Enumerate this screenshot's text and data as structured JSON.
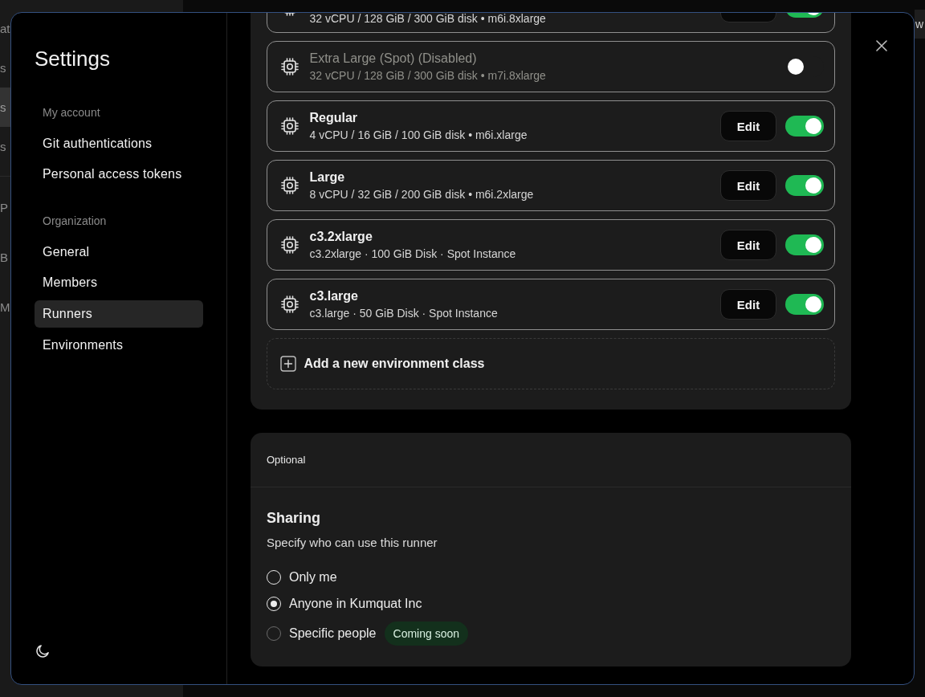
{
  "background": {
    "nav_groups": [
      {
        "items": [
          {
            "text": "at",
            "selected": false
          },
          {
            "text": "s",
            "selected": false
          },
          {
            "text": "s",
            "selected": true
          },
          {
            "text": "s",
            "selected": false
          }
        ]
      },
      {
        "items": [
          {
            "text": "P",
            "selected": false
          },
          {
            "text": "B",
            "selected": false
          },
          {
            "text": "M",
            "selected": false
          }
        ]
      }
    ],
    "top_button": {
      "text": "w"
    }
  },
  "dialog": {
    "sidebar": {
      "title": "Settings",
      "sections": [
        {
          "label": "My account",
          "items": [
            {
              "label": "Git authentications",
              "selected": false
            },
            {
              "label": "Personal access tokens",
              "selected": false
            }
          ]
        },
        {
          "label": "Organization",
          "items": [
            {
              "label": "General",
              "selected": false
            },
            {
              "label": "Members",
              "selected": false
            },
            {
              "label": "Runners",
              "selected": true
            },
            {
              "label": "Environments",
              "selected": false
            }
          ]
        }
      ]
    },
    "environment_classes": [
      {
        "specs": "32 vCPU / 128 GiB / 300 GiB disk • m6i.8xlarge",
        "has_edit": true,
        "enabled": true
      },
      {
        "name": "Extra Large (Spot) (Disabled)",
        "specs": "32 vCPU / 128 GiB / 300 GiB disk • m7i.8xlarge",
        "has_edit": false,
        "enabled": false
      },
      {
        "name": "Regular",
        "specs": "4 vCPU / 16 GiB / 100 GiB disk • m6i.xlarge",
        "has_edit": true,
        "edit_label": "Edit",
        "enabled": true
      },
      {
        "name": "Large",
        "specs": "8 vCPU / 32 GiB / 200 GiB disk • m6i.2xlarge",
        "has_edit": true,
        "edit_label": "Edit",
        "enabled": true
      },
      {
        "name": "c3.2xlarge",
        "specs": "c3.2xlarge · 100 GiB Disk · Spot Instance",
        "has_edit": true,
        "edit_label": "Edit",
        "enabled": true
      },
      {
        "name": "c3.large",
        "specs": "c3.large · 50 GiB Disk · Spot Instance",
        "has_edit": true,
        "edit_label": "Edit",
        "enabled": true
      }
    ],
    "add_class_label": "Add a new environment class",
    "optional": {
      "header": "Optional",
      "title": "Sharing",
      "description": "Specify who can use this runner",
      "options": [
        {
          "label": "Only me",
          "selected": false,
          "disabled": false
        },
        {
          "label": "Anyone in Kumquat Inc",
          "selected": true,
          "disabled": false
        },
        {
          "label": "Specific people",
          "selected": false,
          "disabled": true,
          "badge": "Coming soon"
        }
      ]
    }
  }
}
